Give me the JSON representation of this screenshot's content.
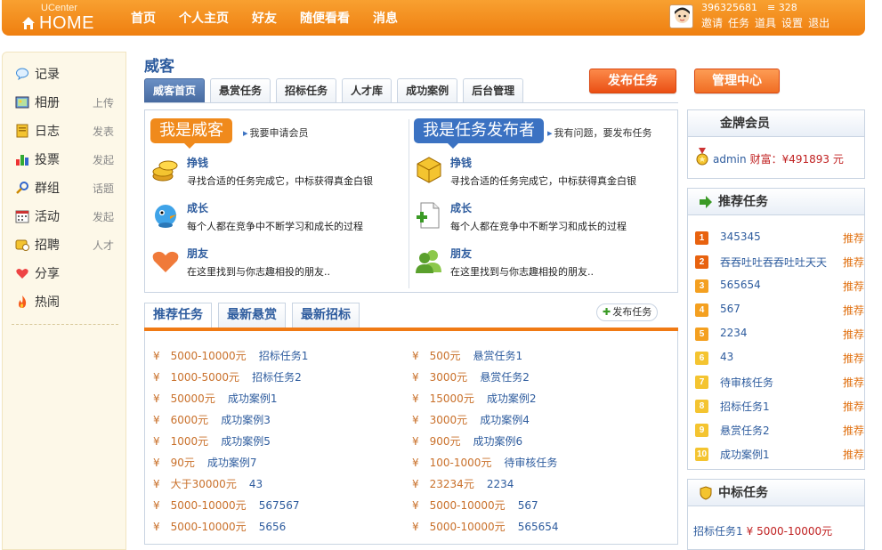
{
  "header": {
    "logo_small": "UCenter",
    "logo_big": "HOME",
    "nav": [
      "首页",
      "个人主页",
      "好友",
      "随便看看",
      "消息"
    ],
    "user_id": "396325681",
    "credit": "328",
    "user_links": [
      "邀请",
      "任务",
      "道具",
      "设置",
      "退出"
    ]
  },
  "sidebar": {
    "items": [
      {
        "label": "记录",
        "sub": "",
        "icon": "chat-bubble-icon"
      },
      {
        "label": "相册",
        "sub": "上传",
        "icon": "photo-album-icon"
      },
      {
        "label": "日志",
        "sub": "发表",
        "icon": "journal-icon"
      },
      {
        "label": "投票",
        "sub": "发起",
        "icon": "poll-chart-icon"
      },
      {
        "label": "群组",
        "sub": "话题",
        "icon": "group-icon"
      },
      {
        "label": "活动",
        "sub": "发起",
        "icon": "calendar-icon"
      },
      {
        "label": "招聘",
        "sub": "人才",
        "icon": "recruit-icon"
      },
      {
        "label": "分享",
        "sub": "",
        "icon": "share-heart-icon"
      },
      {
        "label": "热闹",
        "sub": "",
        "icon": "fire-icon"
      }
    ]
  },
  "main": {
    "title": "威客",
    "tabs": [
      "威客首页",
      "悬赏任务",
      "招标任务",
      "人才库",
      "成功案例",
      "后台管理"
    ],
    "buttons": {
      "publish": "发布任务",
      "admin": "管理中心"
    },
    "intro": {
      "left": {
        "badge": "我是威客",
        "link": "我要申请会员",
        "features": [
          {
            "title": "挣钱",
            "desc": "寻找合适的任务完成它，中标获得真金白银"
          },
          {
            "title": "成长",
            "desc": "每个人都在竞争中不断学习和成长的过程"
          },
          {
            "title": "朋友",
            "desc": "在这里找到与你志趣相投的朋友.."
          }
        ]
      },
      "right": {
        "badge": "我是任务发布者",
        "link": "我有问题，要发布任务",
        "features": [
          {
            "title": "挣钱",
            "desc": "寻找合适的任务完成它，中标获得真金白银"
          },
          {
            "title": "成长",
            "desc": "每个人都在竞争中不断学习和成长的过程"
          },
          {
            "title": "朋友",
            "desc": "在这里找到与你志趣相投的朋友.."
          }
        ]
      }
    },
    "list_tabs": [
      "推荐任务",
      "最新悬赏",
      "最新招标"
    ],
    "post_link": "发布任务",
    "yen": "¥",
    "left_list": [
      {
        "amount": "5000-10000元",
        "name": "招标任务1"
      },
      {
        "amount": "1000-5000元",
        "name": "招标任务2"
      },
      {
        "amount": "50000元",
        "name": "成功案例1"
      },
      {
        "amount": "6000元",
        "name": "成功案例3"
      },
      {
        "amount": "1000元",
        "name": "成功案例5"
      },
      {
        "amount": "90元",
        "name": "成功案例7"
      },
      {
        "amount": "大于30000元",
        "name": "43"
      },
      {
        "amount": "5000-10000元",
        "name": "567567"
      },
      {
        "amount": "5000-10000元",
        "name": "5656"
      }
    ],
    "right_list": [
      {
        "amount": "500元",
        "name": "悬赏任务1"
      },
      {
        "amount": "3000元",
        "name": "悬赏任务2"
      },
      {
        "amount": "15000元",
        "name": "成功案例2"
      },
      {
        "amount": "3000元",
        "name": "成功案例4"
      },
      {
        "amount": "900元",
        "name": "成功案例6"
      },
      {
        "amount": "100-1000元",
        "name": "待审核任务"
      },
      {
        "amount": "23234元",
        "name": "2234"
      },
      {
        "amount": "5000-10000元",
        "name": "567"
      },
      {
        "amount": "5000-10000元",
        "name": "565654"
      }
    ]
  },
  "right": {
    "gold": {
      "title": "金牌会员",
      "member": "admin",
      "wealth": "财富：¥491893 元"
    },
    "recommend": {
      "title": "推荐任务",
      "tag": "推荐",
      "items": [
        {
          "num": "1",
          "name": "345345"
        },
        {
          "num": "2",
          "name": "吞吞吐吐吞吞吐吐天天"
        },
        {
          "num": "3",
          "name": "565654"
        },
        {
          "num": "4",
          "name": "567"
        },
        {
          "num": "5",
          "name": "2234"
        },
        {
          "num": "6",
          "name": "43"
        },
        {
          "num": "7",
          "name": "待审核任务"
        },
        {
          "num": "8",
          "name": "招标任务1"
        },
        {
          "num": "9",
          "name": "悬赏任务2"
        },
        {
          "num": "10",
          "name": "成功案例1"
        }
      ]
    },
    "winning": {
      "title": "中标任务",
      "item_name": "招标任务1",
      "item_amount": "¥ 5000-10000元"
    }
  },
  "colors": {
    "accent_orange": "#f07a14",
    "link_blue": "#2e5c9e",
    "price_red": "#c02020"
  }
}
